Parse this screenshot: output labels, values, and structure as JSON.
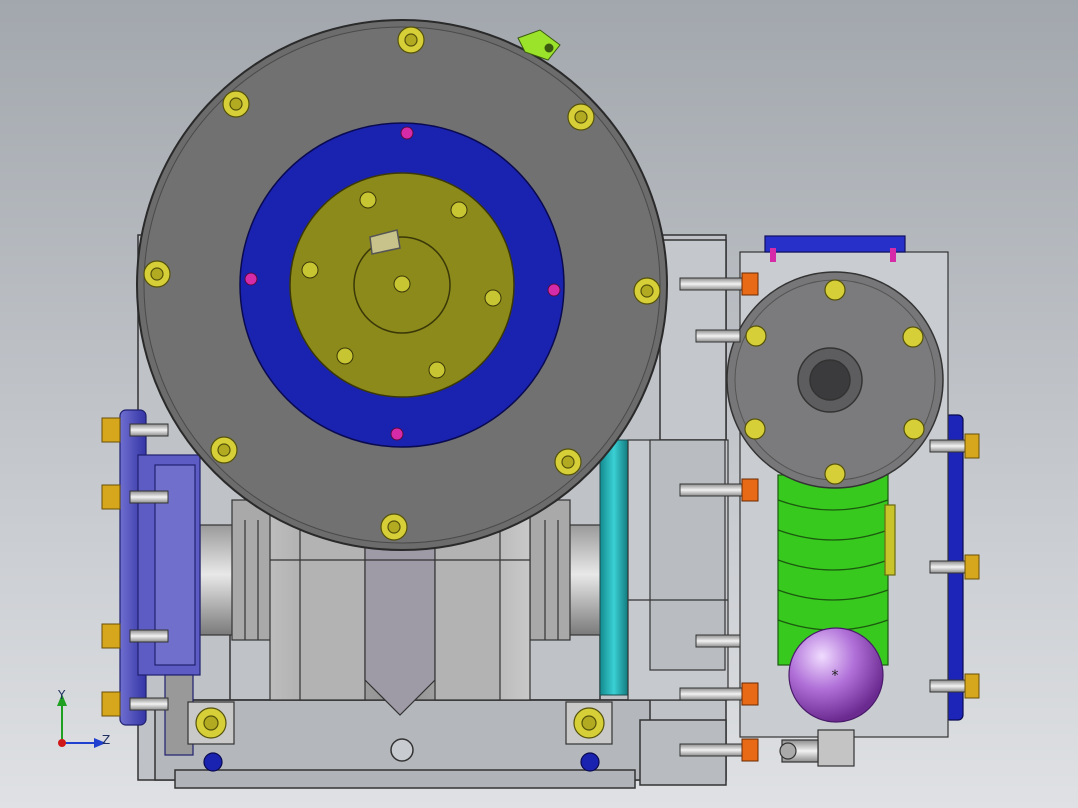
{
  "triad": {
    "y_label": "Y",
    "z_label": "Z",
    "x_color": "#d01818",
    "y_color": "#20a020",
    "z_color": "#2040d0"
  },
  "colors": {
    "background_top": "#a2a7ad",
    "background_bottom": "#dfe1e4",
    "housing_grey": "#6e6e6e",
    "flange_blue": "#1a22b0",
    "hub_olive": "#8c8a1a",
    "bolt_yellow": "#d6cf38",
    "worm_green": "#38c91e",
    "ball_purple": "#b070d8",
    "teal_ring": "#20a8ad",
    "nut_orange": "#e86a16",
    "pin_magenta": "#d62ba8"
  },
  "icons": [
    "coordinate-triad-icon",
    "gearbox-assembly-drawing"
  ]
}
